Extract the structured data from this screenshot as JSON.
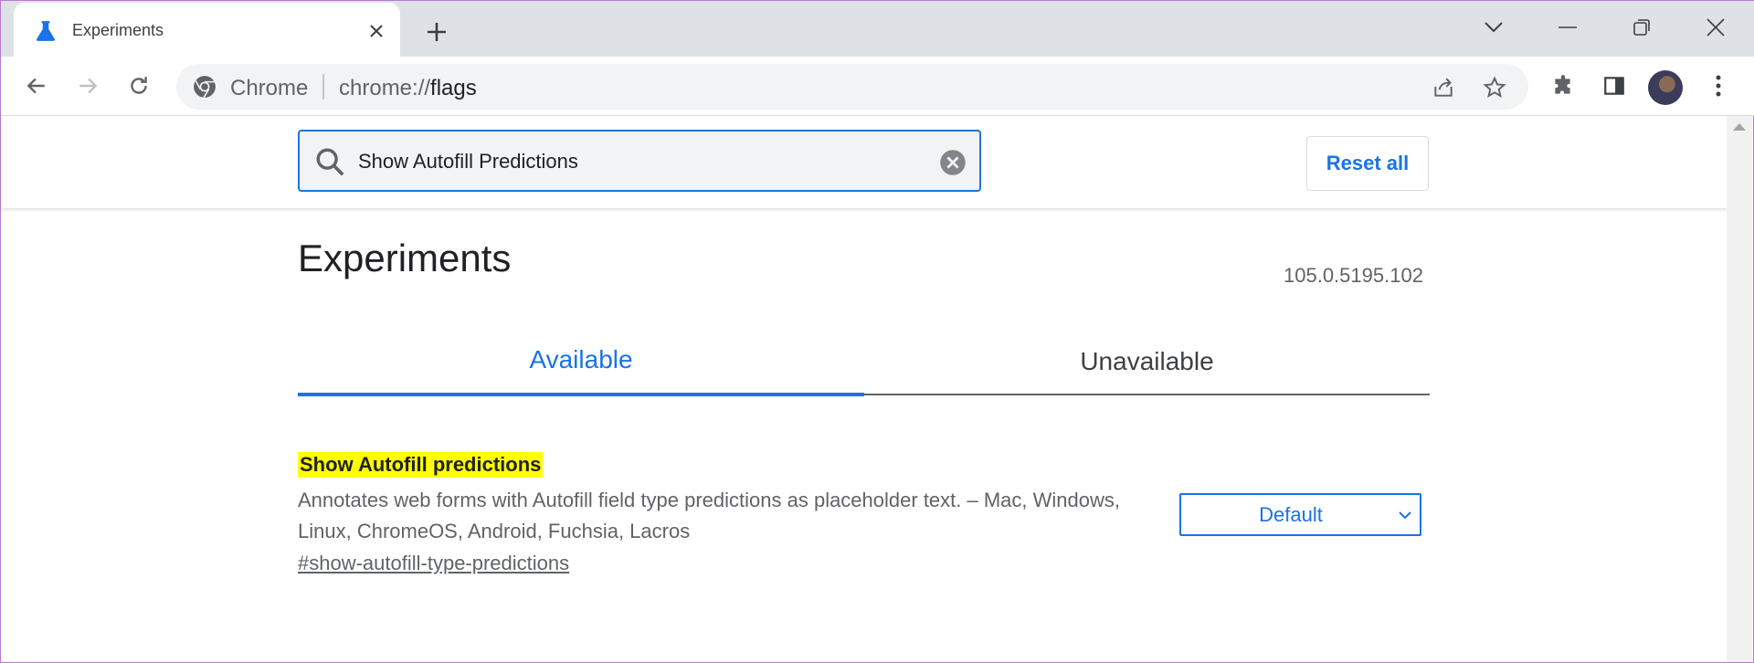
{
  "tab": {
    "title": "Experiments",
    "favicon": "flask-icon"
  },
  "omnibox": {
    "site_label": "Chrome",
    "url_prefix": "chrome://",
    "url_path": "flags"
  },
  "search": {
    "value": "Show Autofill Predictions"
  },
  "reset_label": "Reset all",
  "page": {
    "title": "Experiments",
    "version": "105.0.5195.102"
  },
  "tabs": {
    "available": "Available",
    "unavailable": "Unavailable"
  },
  "flag": {
    "title": "Show Autofill predictions",
    "description": "Annotates web forms with Autofill field type predictions as placeholder text. – Mac, Windows, Linux, ChromeOS, Android, Fuchsia, Lacros",
    "link": "#show-autofill-type-predictions",
    "selected": "Default"
  },
  "colors": {
    "accent": "#1a73e8",
    "highlight": "#ffff00",
    "tabstrip": "#dee1e6"
  }
}
